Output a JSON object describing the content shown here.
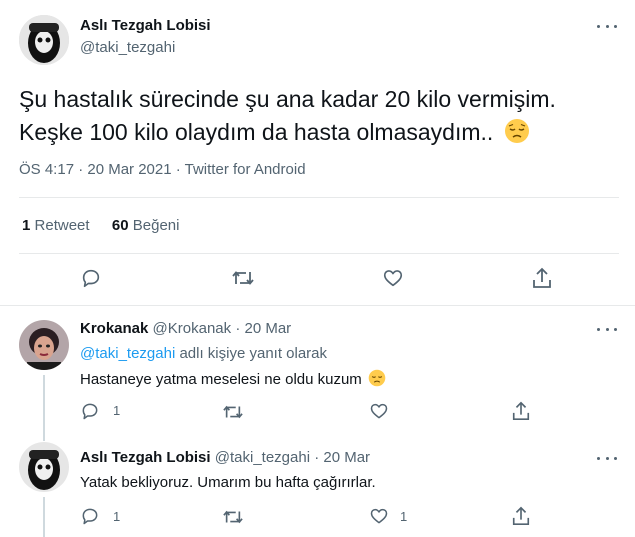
{
  "main_tweet": {
    "display_name": "Aslı Tezgah Lobisi",
    "handle": "@taki_tezgahi",
    "text_line1": "Şu hastalık sürecinde şu ana kadar 20 kilo vermişim.",
    "text_line2": "Keşke 100 kilo olaydım da hasta olmasaydım..",
    "timestamp": "ÖS 4:17 · 20 Mar 2021 · Twitter for Android",
    "retweet_count": "1",
    "retweet_label": "Retweet",
    "like_count": "60",
    "like_label": "Beğeni"
  },
  "replies": [
    {
      "display_name": "Krokanak",
      "handle": "@Krokanak",
      "date": "· 20 Mar",
      "reply_to_handle": "@taki_tezgahi",
      "reply_to_suffix": "adlı kişiye yanıt olarak",
      "text": "Hastaneye yatma meselesi ne oldu kuzum",
      "reply_count": "1",
      "like_count": ""
    },
    {
      "display_name": "Aslı Tezgah Lobisi",
      "handle": "@taki_tezgahi",
      "date": "· 20 Mar",
      "text": "Yatak bekliyoruz. Umarım bu hafta çağırırlar.",
      "reply_count": "1",
      "like_count": "1"
    }
  ],
  "colors": {
    "accent": "#1d9bf0",
    "muted": "#536471",
    "divider": "#e7e9ea"
  },
  "icons": [
    "more-icon",
    "reply-icon",
    "retweet-icon",
    "like-icon",
    "share-icon",
    "pensive-emoji-icon"
  ]
}
